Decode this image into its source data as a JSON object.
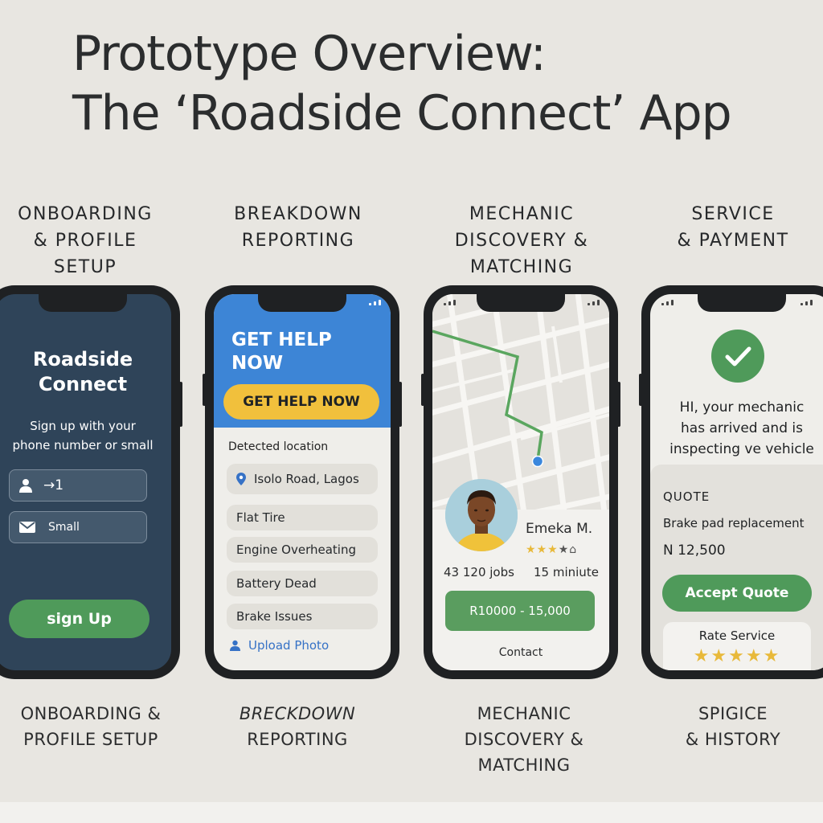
{
  "title": {
    "line1": "Prototype Overview:",
    "line2": "The ‘Roadside Connect’ App"
  },
  "columns": [
    {
      "head": [
        "ONBOARDING",
        "& PROFILE SETUP"
      ],
      "foot": [
        "ONBOARDING &",
        "PROFILE SETUP"
      ]
    },
    {
      "head": [
        "BREAKDOWN",
        "REPORTING"
      ],
      "foot": [
        "BRECKDOWN",
        "REPORTING"
      ]
    },
    {
      "head": [
        "MECHANIC",
        "DISCOVERY &",
        "MATCHING"
      ],
      "foot": [
        "MECHANIC",
        "DISCOVERY &",
        "MATCHING"
      ]
    },
    {
      "head": [
        "SERVICE",
        "& PAYMENT"
      ],
      "foot": [
        "SPIGICE",
        "& HISTORY"
      ]
    }
  ],
  "onboarding": {
    "app_name_line1": "Roadside",
    "app_name_line2": "Connect",
    "subtitle_line1": "Sign up with your",
    "subtitle_line2": "phone number or small",
    "phone_value": "→1",
    "email_value": "Small",
    "signup_label": "sign Up"
  },
  "breakdown": {
    "hero_line1": "GET HELP",
    "hero_line2": "NOW",
    "help_button": "GET HELP NOW",
    "detected_label": "Detected location",
    "location": "Isolo Road, Lagos",
    "issues": [
      "Flat Tire",
      "Engine Overheating",
      "Battery Dead",
      "Brake Issues"
    ],
    "upload_label": "Upload Photo"
  },
  "mechanic": {
    "name": "Emeka M.",
    "rating": 3,
    "rating_max": 5,
    "jobs": "43 120 jobs",
    "eta": "15 miniute",
    "price_range": "R10000 - 15,000",
    "contact_label": "Contact"
  },
  "service": {
    "message_line1": "HI, your mechanic",
    "message_line2": "has arrived and is",
    "message_line3": "inspecting ve vehicle",
    "quote_label": "QUOTE",
    "quote_item": "Brake pad replacement",
    "quote_price": "N 12,500",
    "accept_label": "Accept Quote",
    "rate_label": "Rate Service",
    "rate_stars": 5
  },
  "colors": {
    "background": "#e8e6e1",
    "onboarding_screen": "#2f4459",
    "hero_blue": "#3d85d6",
    "help_yellow": "#f1c03c",
    "accent_green": "#4f9a5a",
    "star_gold": "#e8b93a"
  }
}
